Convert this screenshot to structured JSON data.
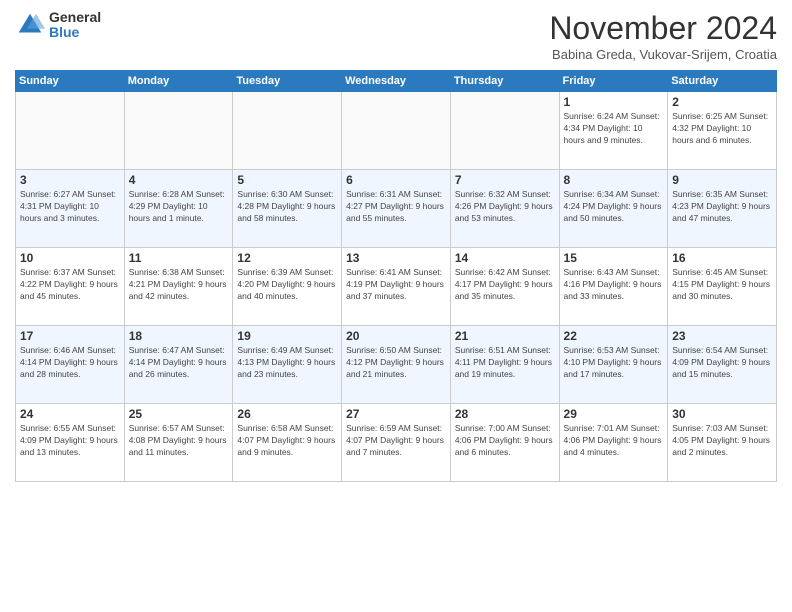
{
  "header": {
    "logo_general": "General",
    "logo_blue": "Blue",
    "month_title": "November 2024",
    "subtitle": "Babina Greda, Vukovar-Srijem, Croatia"
  },
  "days_of_week": [
    "Sunday",
    "Monday",
    "Tuesday",
    "Wednesday",
    "Thursday",
    "Friday",
    "Saturday"
  ],
  "weeks": [
    {
      "days": [
        {
          "date": "",
          "info": ""
        },
        {
          "date": "",
          "info": ""
        },
        {
          "date": "",
          "info": ""
        },
        {
          "date": "",
          "info": ""
        },
        {
          "date": "",
          "info": ""
        },
        {
          "date": "1",
          "info": "Sunrise: 6:24 AM\nSunset: 4:34 PM\nDaylight: 10 hours and 9 minutes."
        },
        {
          "date": "2",
          "info": "Sunrise: 6:25 AM\nSunset: 4:32 PM\nDaylight: 10 hours and 6 minutes."
        }
      ]
    },
    {
      "days": [
        {
          "date": "3",
          "info": "Sunrise: 6:27 AM\nSunset: 4:31 PM\nDaylight: 10 hours and 3 minutes."
        },
        {
          "date": "4",
          "info": "Sunrise: 6:28 AM\nSunset: 4:29 PM\nDaylight: 10 hours and 1 minute."
        },
        {
          "date": "5",
          "info": "Sunrise: 6:30 AM\nSunset: 4:28 PM\nDaylight: 9 hours and 58 minutes."
        },
        {
          "date": "6",
          "info": "Sunrise: 6:31 AM\nSunset: 4:27 PM\nDaylight: 9 hours and 55 minutes."
        },
        {
          "date": "7",
          "info": "Sunrise: 6:32 AM\nSunset: 4:26 PM\nDaylight: 9 hours and 53 minutes."
        },
        {
          "date": "8",
          "info": "Sunrise: 6:34 AM\nSunset: 4:24 PM\nDaylight: 9 hours and 50 minutes."
        },
        {
          "date": "9",
          "info": "Sunrise: 6:35 AM\nSunset: 4:23 PM\nDaylight: 9 hours and 47 minutes."
        }
      ]
    },
    {
      "days": [
        {
          "date": "10",
          "info": "Sunrise: 6:37 AM\nSunset: 4:22 PM\nDaylight: 9 hours and 45 minutes."
        },
        {
          "date": "11",
          "info": "Sunrise: 6:38 AM\nSunset: 4:21 PM\nDaylight: 9 hours and 42 minutes."
        },
        {
          "date": "12",
          "info": "Sunrise: 6:39 AM\nSunset: 4:20 PM\nDaylight: 9 hours and 40 minutes."
        },
        {
          "date": "13",
          "info": "Sunrise: 6:41 AM\nSunset: 4:19 PM\nDaylight: 9 hours and 37 minutes."
        },
        {
          "date": "14",
          "info": "Sunrise: 6:42 AM\nSunset: 4:17 PM\nDaylight: 9 hours and 35 minutes."
        },
        {
          "date": "15",
          "info": "Sunrise: 6:43 AM\nSunset: 4:16 PM\nDaylight: 9 hours and 33 minutes."
        },
        {
          "date": "16",
          "info": "Sunrise: 6:45 AM\nSunset: 4:15 PM\nDaylight: 9 hours and 30 minutes."
        }
      ]
    },
    {
      "days": [
        {
          "date": "17",
          "info": "Sunrise: 6:46 AM\nSunset: 4:14 PM\nDaylight: 9 hours and 28 minutes."
        },
        {
          "date": "18",
          "info": "Sunrise: 6:47 AM\nSunset: 4:14 PM\nDaylight: 9 hours and 26 minutes."
        },
        {
          "date": "19",
          "info": "Sunrise: 6:49 AM\nSunset: 4:13 PM\nDaylight: 9 hours and 23 minutes."
        },
        {
          "date": "20",
          "info": "Sunrise: 6:50 AM\nSunset: 4:12 PM\nDaylight: 9 hours and 21 minutes."
        },
        {
          "date": "21",
          "info": "Sunrise: 6:51 AM\nSunset: 4:11 PM\nDaylight: 9 hours and 19 minutes."
        },
        {
          "date": "22",
          "info": "Sunrise: 6:53 AM\nSunset: 4:10 PM\nDaylight: 9 hours and 17 minutes."
        },
        {
          "date": "23",
          "info": "Sunrise: 6:54 AM\nSunset: 4:09 PM\nDaylight: 9 hours and 15 minutes."
        }
      ]
    },
    {
      "days": [
        {
          "date": "24",
          "info": "Sunrise: 6:55 AM\nSunset: 4:09 PM\nDaylight: 9 hours and 13 minutes."
        },
        {
          "date": "25",
          "info": "Sunrise: 6:57 AM\nSunset: 4:08 PM\nDaylight: 9 hours and 11 minutes."
        },
        {
          "date": "26",
          "info": "Sunrise: 6:58 AM\nSunset: 4:07 PM\nDaylight: 9 hours and 9 minutes."
        },
        {
          "date": "27",
          "info": "Sunrise: 6:59 AM\nSunset: 4:07 PM\nDaylight: 9 hours and 7 minutes."
        },
        {
          "date": "28",
          "info": "Sunrise: 7:00 AM\nSunset: 4:06 PM\nDaylight: 9 hours and 6 minutes."
        },
        {
          "date": "29",
          "info": "Sunrise: 7:01 AM\nSunset: 4:06 PM\nDaylight: 9 hours and 4 minutes."
        },
        {
          "date": "30",
          "info": "Sunrise: 7:03 AM\nSunset: 4:05 PM\nDaylight: 9 hours and 2 minutes."
        }
      ]
    }
  ]
}
